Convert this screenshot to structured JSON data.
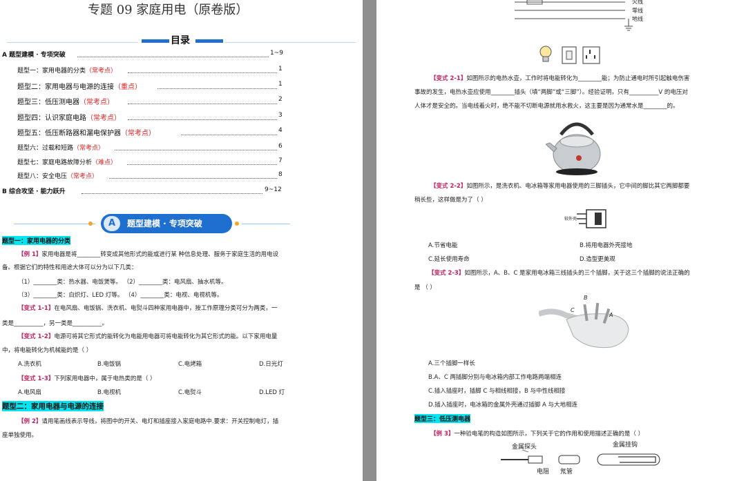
{
  "left_page": {
    "doc_title": "专题 09  家庭用电（原卷版）",
    "toc_heading": "目录",
    "toc": [
      {
        "label": "A 题型建模 · 专项突破",
        "tag": "",
        "page": "1~9"
      },
      {
        "label": "题型一：家用电器的分类",
        "tag": "（常考点）",
        "page": "1"
      },
      {
        "label": "题型二：家用电器与电源的连接",
        "tag": "（重点）",
        "page": "1"
      },
      {
        "label": "题型三：低压测电器",
        "tag": "（常考点）",
        "page": "2"
      },
      {
        "label": "题型四：认识家庭电路",
        "tag": "（常考点）",
        "page": "3"
      },
      {
        "label": "题型五：低压断路器和漏电保护器",
        "tag": "（常考点）",
        "page": "4"
      },
      {
        "label": "题型六：过载和短路",
        "tag": "（常考点）",
        "page": "6"
      },
      {
        "label": "题型七：家庭电路故障分析",
        "tag": "（难点）",
        "page": "7"
      },
      {
        "label": "题型八：安全电压",
        "tag": "（常考点）",
        "page": "8"
      },
      {
        "label": "B 综合攻坚 · 能力跃升",
        "tag": "",
        "page": "9~12"
      }
    ],
    "banner_letter": "A",
    "banner_text": "题型建模 · 专项突破",
    "section1_title": "题型一：家用电器的分类",
    "ex1_tag": "【例 1】",
    "ex1_line1": "家用电器是将________转变成其他形式的能或进行某 种信息处理、服务于家庭生活的用电设",
    "ex1_line2": "备。根据它们的特性和用途大体可以分为以下几类：",
    "ex1_line3": "（1）________类：热水器、电饭煲等。        （2）________类：电风扇、抽水机等。",
    "ex1_line4": "（3）________类：白炽灯、LED 灯等。        （4）________类：电视、电视机等。",
    "v11_tag": "【变式 1-1】",
    "v11_line1": "在电风扇、电饭锅、洗衣机、电熨斗四种家用电器中，按工作原理分类可分为两类，一",
    "v11_line2": "类是__________，另一类是__________。",
    "v12_tag": "【变式 1-2】",
    "v12_line1": "电源可将其它形式的能转化为电能用电器可将电能转化为其它形式的能。以下家用电量",
    "v12_line2": "中，将电能转化为机械能的是（     ）",
    "v12_opts": [
      "A.洗衣机",
      "B.电饭锅",
      "C.电烤箱",
      "D.日光灯"
    ],
    "v13_tag": "【变式 1-3】",
    "v13_line1": "下列家用电器中，属于电热类的是（     ）",
    "v13_opts": [
      "A.电风扇",
      "B.电视机",
      "C.电熨斗",
      "D.LED 灯"
    ],
    "section2_title": "题型二：家用电器与电源的连接",
    "ex2_tag": "【例 2】",
    "ex2_line1": "请用笔画线表示导线，将图中的开关、电灯和插座接入家庭电路中.要求：开关控制电灯，插",
    "ex2_line2": "座单独使用。"
  },
  "right_page": {
    "wire_labels": [
      "火线",
      "零线",
      "地线"
    ],
    "v21_tag": "【变式 2-1】",
    "v21_line1": "如图所示的电热水壶，工作时将电能转化为________能；为防止通电时所引起触电伤害",
    "v21_line2": "事故的发生，电热水壶应使用________插头（填“两脚”或“三脚”）。经验证明，只有__________V 的电压对",
    "v21_line3": "人体才是安全的。当电线着火时，绝不能不切断电源就用水救火，这主要是因为通常水是________的。",
    "v22_tag": "【变式 2-2】",
    "v22_line1": "如图所示，是洗衣机、电冰箱等家用电器使用的三脚插头，它中间的脚比其它两脚都要",
    "v22_line2": "稍长些，这样做是为了（     ）",
    "plug_label": "较外壳",
    "v22_opts": [
      "A.节省电能",
      "B.将用电器外壳接地",
      "C.延长使用寿命",
      "D.造型更美观"
    ],
    "v23_tag": "【变式 2-3】",
    "v23_line1": "如图所示，A、B、C 是家用电冰箱三线插头的三个插脚，关于这三个插脚的说法正确的",
    "v23_line2": "是                                        （     ）",
    "pin_labels": [
      "B",
      "C",
      "A"
    ],
    "v23_opts": [
      "A.三个插脚一样长",
      "B.A、C 两插脚分别与电冰箱内部工作电路两端相连",
      "C.插入插座时，插脚 C 与相线相接，B 与中性线相接",
      "D.插入插座时，电冰箱的金属外壳通过插脚 A 与大地相连"
    ],
    "section3_title": "题型三：低压测电器",
    "ex3_tag": "【例 3】",
    "ex3_line1": "一种验电笔的构造如图所示，下列关于它的作用和使用描述正确的是（     ）",
    "pen_labels": [
      "金属探头",
      "金属挂钩",
      "电阻",
      "氖管"
    ]
  },
  "colors": {
    "accent_blue": "#1f6fd1",
    "red": "#e02020",
    "tag_magenta": "#c02060",
    "highlight_cyan": "#00e5f0",
    "gutter_gray": "#8f8f8f"
  }
}
